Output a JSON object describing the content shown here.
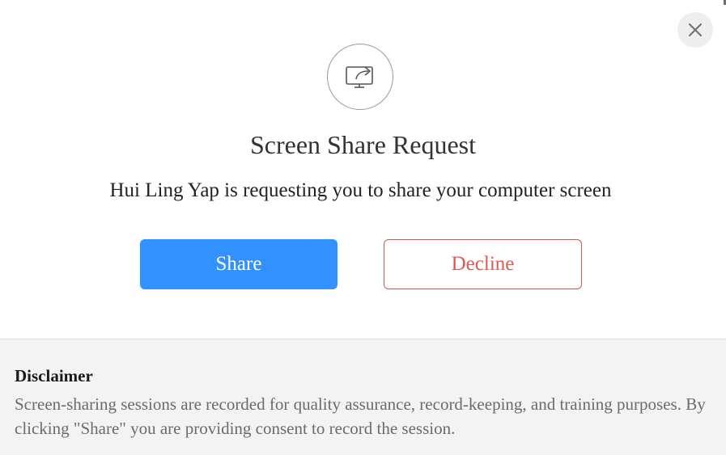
{
  "dialog": {
    "title": "Screen Share Request",
    "message": "Hui Ling Yap is requesting you to share your computer screen",
    "share_label": "Share",
    "decline_label": "Decline",
    "icon": "screen-share-icon",
    "close_icon": "close-icon"
  },
  "disclaimer": {
    "title": "Disclaimer",
    "text": "Screen-sharing sessions are recorded for quality assurance, record-keeping, and training purposes. By clicking \"Share\" you are providing consent to record the session."
  },
  "colors": {
    "share_button": "#3091ff",
    "decline_text": "#e05a55",
    "disclaimer_bg": "#f3f3f3"
  }
}
